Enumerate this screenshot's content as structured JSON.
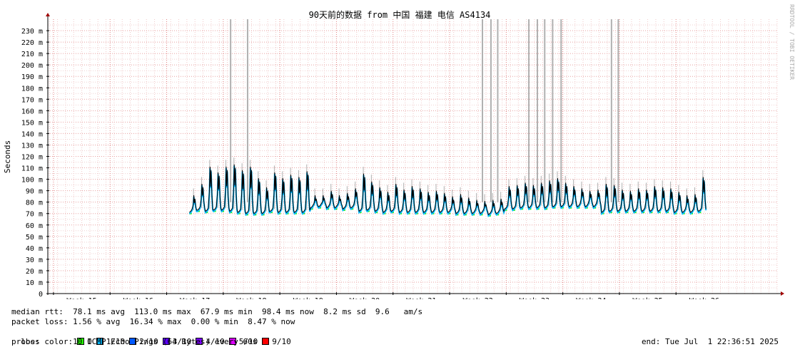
{
  "chart_data": {
    "type": "line",
    "title": "90天前的数据 from 中国 福建 电信 AS4134",
    "ylabel": "Seconds",
    "watermark": "RRDTOOL / TOBI OETIKER",
    "ylim": [
      0,
      240
    ],
    "y_ticks": [
      "0",
      "10 m",
      "20 m",
      "30 m",
      "40 m",
      "50 m",
      "60 m",
      "70 m",
      "80 m",
      "90 m",
      "100 m",
      "110 m",
      "120 m",
      "130 m",
      "140 m",
      "150 m",
      "160 m",
      "170 m",
      "180 m",
      "190 m",
      "200 m",
      "210 m",
      "220 m",
      "230 m"
    ],
    "y_tick_values": [
      0,
      10,
      20,
      30,
      40,
      50,
      60,
      70,
      80,
      90,
      100,
      110,
      120,
      130,
      140,
      150,
      160,
      170,
      180,
      190,
      200,
      210,
      220,
      230
    ],
    "x_week_range": [
      14.4,
      27.3
    ],
    "x_ticks": [
      "Week 15",
      "Week 16",
      "Week 17",
      "Week 18",
      "Week 19",
      "Week 20",
      "Week 21",
      "Week 22",
      "Week 23",
      "Week 24",
      "Week 25",
      "Week 26"
    ],
    "x_tick_values": [
      15,
      16,
      17,
      18,
      19,
      20,
      21,
      22,
      23,
      24,
      25,
      26
    ],
    "data_start_week": 16.9,
    "daily_rtt_ms": [
      {
        "base": 71,
        "peak": 86
      },
      {
        "base": 73,
        "peak": 96
      },
      {
        "base": 72,
        "peak": 111
      },
      {
        "base": 73,
        "peak": 106
      },
      {
        "base": 73,
        "peak": 111
      },
      {
        "base": 72,
        "peak": 113
      },
      {
        "base": 71,
        "peak": 108
      },
      {
        "base": 70,
        "peak": 111
      },
      {
        "base": 70,
        "peak": 101
      },
      {
        "base": 70,
        "peak": 93
      },
      {
        "base": 72,
        "peak": 106
      },
      {
        "base": 71,
        "peak": 101
      },
      {
        "base": 71,
        "peak": 104
      },
      {
        "base": 71,
        "peak": 102
      },
      {
        "base": 71,
        "peak": 107
      },
      {
        "base": 75,
        "peak": 86
      },
      {
        "base": 76,
        "peak": 86
      },
      {
        "base": 75,
        "peak": 90
      },
      {
        "base": 75,
        "peak": 86
      },
      {
        "base": 74,
        "peak": 88
      },
      {
        "base": 75,
        "peak": 92
      },
      {
        "base": 72,
        "peak": 105
      },
      {
        "base": 73,
        "peak": 98
      },
      {
        "base": 72,
        "peak": 93
      },
      {
        "base": 71,
        "peak": 89
      },
      {
        "base": 72,
        "peak": 96
      },
      {
        "base": 71,
        "peak": 91
      },
      {
        "base": 71,
        "peak": 94
      },
      {
        "base": 71,
        "peak": 92
      },
      {
        "base": 71,
        "peak": 89
      },
      {
        "base": 71,
        "peak": 90
      },
      {
        "base": 71,
        "peak": 88
      },
      {
        "base": 71,
        "peak": 85
      },
      {
        "base": 70,
        "peak": 87
      },
      {
        "base": 70,
        "peak": 84
      },
      {
        "base": 70,
        "peak": 82
      },
      {
        "base": 70,
        "peak": 81
      },
      {
        "base": 69,
        "peak": 82
      },
      {
        "base": 70,
        "peak": 83
      },
      {
        "base": 74,
        "peak": 94
      },
      {
        "base": 74,
        "peak": 95
      },
      {
        "base": 75,
        "peak": 97
      },
      {
        "base": 75,
        "peak": 95
      },
      {
        "base": 75,
        "peak": 97
      },
      {
        "base": 75,
        "peak": 99
      },
      {
        "base": 76,
        "peak": 101
      },
      {
        "base": 76,
        "peak": 97
      },
      {
        "base": 76,
        "peak": 94
      },
      {
        "base": 76,
        "peak": 92
      },
      {
        "base": 76,
        "peak": 90
      },
      {
        "base": 76,
        "peak": 91
      },
      {
        "base": 71,
        "peak": 96
      },
      {
        "base": 72,
        "peak": 95
      },
      {
        "base": 72,
        "peak": 91
      },
      {
        "base": 72,
        "peak": 90
      },
      {
        "base": 72,
        "peak": 92
      },
      {
        "base": 72,
        "peak": 91
      },
      {
        "base": 72,
        "peak": 94
      },
      {
        "base": 72,
        "peak": 93
      },
      {
        "base": 72,
        "peak": 92
      },
      {
        "base": 71,
        "peak": 89
      },
      {
        "base": 71,
        "peak": 86
      },
      {
        "base": 71,
        "peak": 87
      },
      {
        "base": 72,
        "peak": 102
      }
    ],
    "loss_spike_weeks": [
      17.63,
      17.93,
      22.08,
      22.23,
      22.35,
      22.9,
      23.05,
      23.18,
      23.32,
      23.47,
      24.36,
      24.48
    ],
    "series_colors": {
      "median": "#000000",
      "smoke": "#b0b0b0",
      "loss_0": "#26ff00",
      "loss_1": "#00b8ff",
      "loss_2": "#0059ff"
    },
    "grid": true
  },
  "stats": {
    "median_rtt": "median rtt:  78.1 ms avg  113.0 ms max  67.9 ms min  98.4 ms now  8.2 ms sd  9.6   am/s",
    "packet_loss": "packet loss: 1.56 % avg  16.34 % max  0.00 % min  8.47 % now",
    "loss_color_label": "loss color:",
    "loss_colors": [
      {
        "label": "0",
        "color": "#26ff00"
      },
      {
        "label": "1/10",
        "color": "#00b8ff"
      },
      {
        "label": "2/10",
        "color": "#0059ff"
      },
      {
        "label": "3/10",
        "color": "#5d00ff"
      },
      {
        "label": "4/10",
        "color": "#7e00ff"
      },
      {
        "label": "5/10",
        "color": "#dd00ff"
      },
      {
        "label": "9/10",
        "color": "#ff0000"
      }
    ],
    "probe": "probe:       10 ICMP Echo Pings (64 Bytes) every 60s",
    "end": "end: Tue Jul  1 22:36:51 2025"
  }
}
